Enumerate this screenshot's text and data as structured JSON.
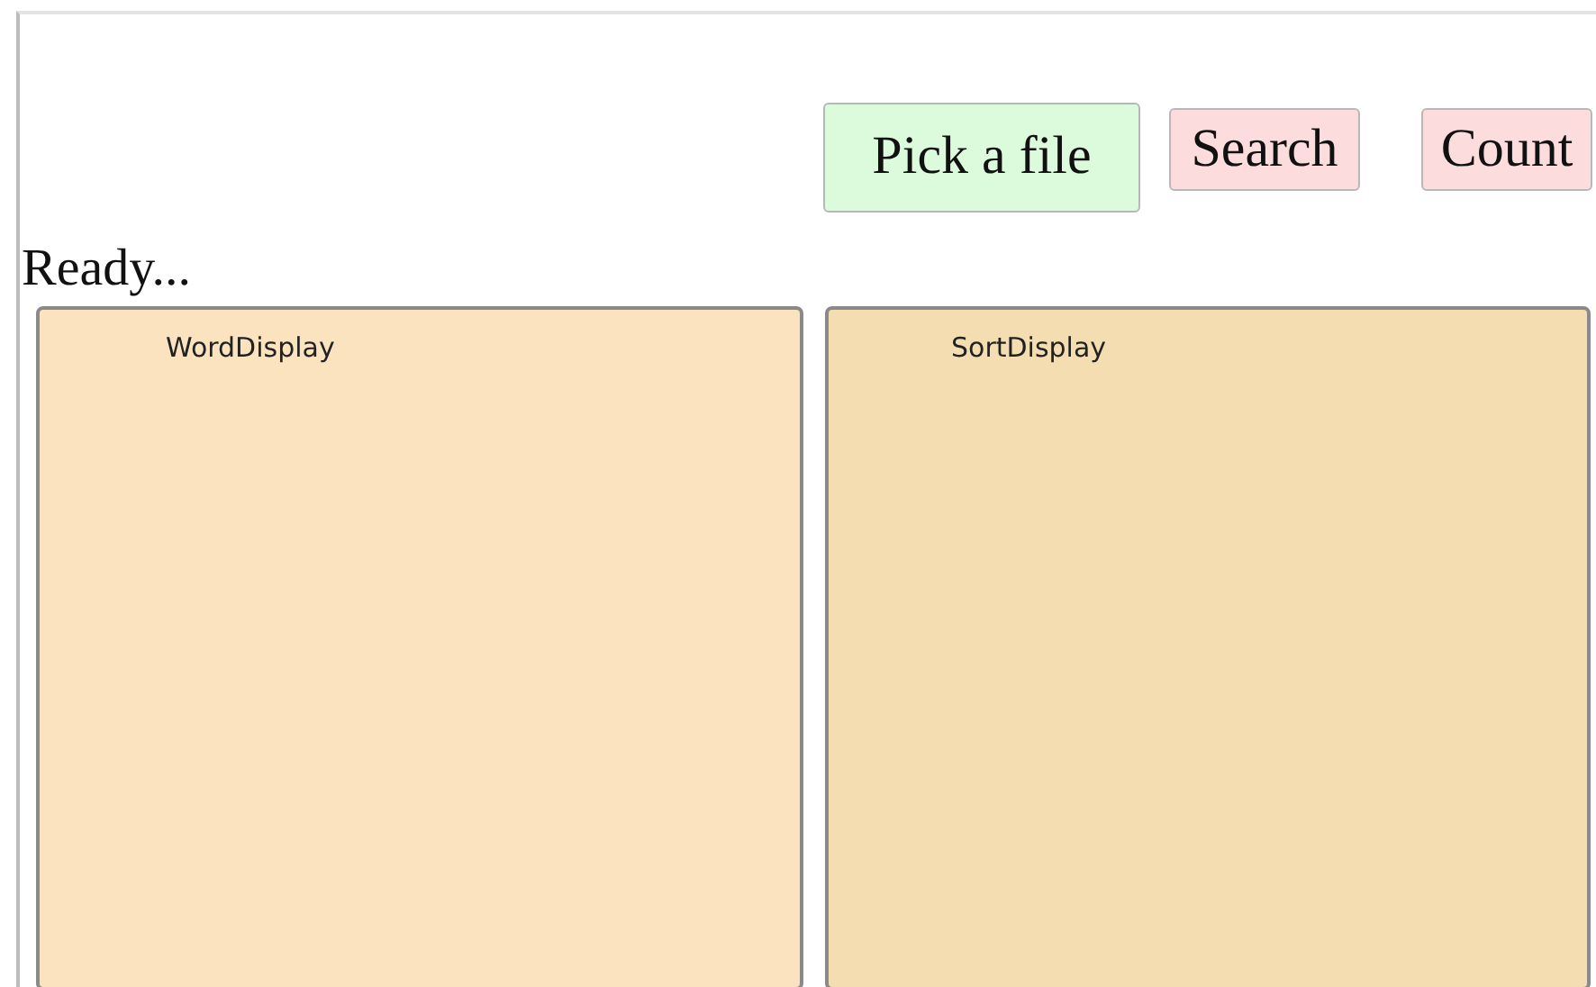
{
  "buttons": [
    {
      "label": "Pick a file",
      "color": "#dcfadc"
    },
    {
      "label": "Search",
      "color": "#fcdcdc"
    },
    {
      "label": "Count",
      "color": "#fcdcdc"
    }
  ],
  "status": "Ready...",
  "panels": [
    {
      "label": "WordDisplay",
      "color": "#fce3c0"
    },
    {
      "label": "SortDisplay",
      "color": "#f3ddb1"
    }
  ]
}
